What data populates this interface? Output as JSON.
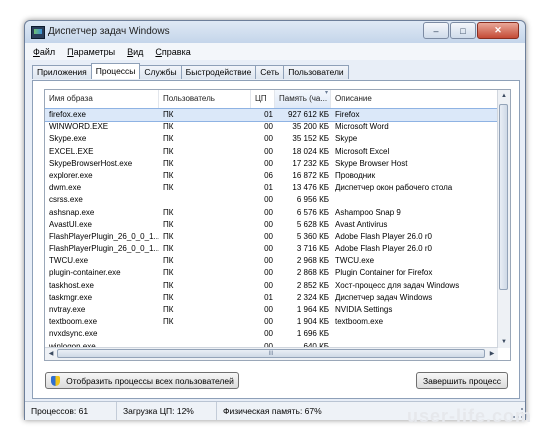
{
  "window": {
    "title": "Диспетчер задач Windows",
    "controls": [
      "–",
      "□",
      "✕"
    ]
  },
  "menu": [
    "Файл",
    "Параметры",
    "Вид",
    "Справка"
  ],
  "tabs": [
    {
      "label": "Приложения",
      "active": false
    },
    {
      "label": "Процессы",
      "active": true
    },
    {
      "label": "Службы",
      "active": false
    },
    {
      "label": "Быстродействие",
      "active": false
    },
    {
      "label": "Сеть",
      "active": false
    },
    {
      "label": "Пользователи",
      "active": false
    }
  ],
  "columns": {
    "name": "Имя образа",
    "user": "Пользователь",
    "cpu": "ЦП",
    "memory": "Память (ча...",
    "description": "Описание"
  },
  "processes": [
    {
      "name": "firefox.exe",
      "user": "ПК",
      "cpu": "01",
      "mem": "927 612 КБ",
      "desc": "Firefox"
    },
    {
      "name": "WINWORD.EXE",
      "user": "ПК",
      "cpu": "00",
      "mem": "35 200 КБ",
      "desc": "Microsoft Word"
    },
    {
      "name": "Skype.exe",
      "user": "ПК",
      "cpu": "00",
      "mem": "35 152 КБ",
      "desc": "Skype"
    },
    {
      "name": "EXCEL.EXE",
      "user": "ПК",
      "cpu": "00",
      "mem": "18 024 КБ",
      "desc": "Microsoft Excel"
    },
    {
      "name": "SkypeBrowserHost.exe",
      "user": "ПК",
      "cpu": "00",
      "mem": "17 232 КБ",
      "desc": "Skype Browser Host"
    },
    {
      "name": "explorer.exe",
      "user": "ПК",
      "cpu": "06",
      "mem": "16 872 КБ",
      "desc": "Проводник"
    },
    {
      "name": "dwm.exe",
      "user": "ПК",
      "cpu": "01",
      "mem": "13 476 КБ",
      "desc": "Диспетчер окон рабочего стола"
    },
    {
      "name": "csrss.exe",
      "user": "",
      "cpu": "00",
      "mem": "6 956 КБ",
      "desc": ""
    },
    {
      "name": "ashsnap.exe",
      "user": "ПК",
      "cpu": "00",
      "mem": "6 576 КБ",
      "desc": "Ashampoo Snap 9"
    },
    {
      "name": "AvastUI.exe",
      "user": "ПК",
      "cpu": "00",
      "mem": "5 628 КБ",
      "desc": "Avast Antivirus"
    },
    {
      "name": "FlashPlayerPlugin_26_0_0_1...",
      "user": "ПК",
      "cpu": "00",
      "mem": "5 360 КБ",
      "desc": "Adobe Flash Player 26.0 r0"
    },
    {
      "name": "FlashPlayerPlugin_26_0_0_1...",
      "user": "ПК",
      "cpu": "00",
      "mem": "3 716 КБ",
      "desc": "Adobe Flash Player 26.0 r0"
    },
    {
      "name": "TWCU.exe",
      "user": "ПК",
      "cpu": "00",
      "mem": "2 968 КБ",
      "desc": "TWCU.exe"
    },
    {
      "name": "plugin-container.exe",
      "user": "ПК",
      "cpu": "00",
      "mem": "2 868 КБ",
      "desc": "Plugin Container for Firefox"
    },
    {
      "name": "taskhost.exe",
      "user": "ПК",
      "cpu": "00",
      "mem": "2 852 КБ",
      "desc": "Хост-процесс для задач Windows"
    },
    {
      "name": "taskmgr.exe",
      "user": "ПК",
      "cpu": "01",
      "mem": "2 324 КБ",
      "desc": "Диспетчер задач Windows"
    },
    {
      "name": "nvtray.exe",
      "user": "ПК",
      "cpu": "00",
      "mem": "1 964 КБ",
      "desc": "NVIDIA Settings"
    },
    {
      "name": "textboom.exe",
      "user": "ПК",
      "cpu": "00",
      "mem": "1 904 КБ",
      "desc": "textboom.exe"
    },
    {
      "name": "nvxdsync.exe",
      "user": "",
      "cpu": "00",
      "mem": "1 696 КБ",
      "desc": ""
    },
    {
      "name": "winlogon.exe",
      "user": "",
      "cpu": "00",
      "mem": "640 КБ",
      "desc": ""
    }
  ],
  "buttons": {
    "show_all": "Отобразить процессы всех пользователей",
    "end_process": "Завершить процесс"
  },
  "status": {
    "processes": "Процессов: 61",
    "cpu": "Загрузка ЦП: 12%",
    "memory": "Физическая память: 67%"
  },
  "watermark": "user-life.com"
}
